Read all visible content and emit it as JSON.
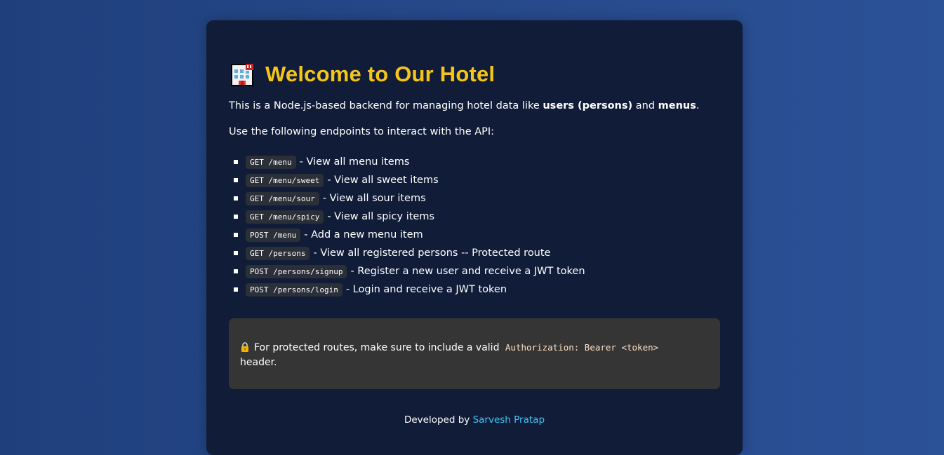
{
  "header": {
    "title": "Welcome to Our Hotel",
    "icon": "hotel-icon"
  },
  "intro": {
    "prefix": "This is a Node.js-based backend for managing hotel data like ",
    "bold1": "users (persons)",
    "middle": " and ",
    "bold2": "menus",
    "suffix": "."
  },
  "use_line": "Use the following endpoints to interact with the API:",
  "endpoints": [
    {
      "code": "GET /menu",
      "desc": "- View all menu items"
    },
    {
      "code": "GET /menu/sweet",
      "desc": "- View all sweet items"
    },
    {
      "code": "GET /menu/sour",
      "desc": "- View all sour items"
    },
    {
      "code": "GET /menu/spicy",
      "desc": "- View all spicy items"
    },
    {
      "code": "POST /menu",
      "desc": "- Add a new menu item"
    },
    {
      "code": "GET /persons",
      "desc": "- View all registered persons -- Protected route"
    },
    {
      "code": "POST /persons/signup",
      "desc": "- Register a new user and receive a JWT token"
    },
    {
      "code": "POST /persons/login",
      "desc": "- Login and receive a JWT token"
    }
  ],
  "note": {
    "icon": "lock-icon",
    "prefix": "For protected routes, make sure to include a valid",
    "code": "Authorization: Bearer <token>",
    "suffix": "header."
  },
  "footer": {
    "prefix": "Developed by",
    "link": "Sarvesh Pratap"
  },
  "colors": {
    "title": "#f5c518",
    "link": "#42c5f5",
    "card": "#101c38",
    "note_bg": "#353535"
  }
}
